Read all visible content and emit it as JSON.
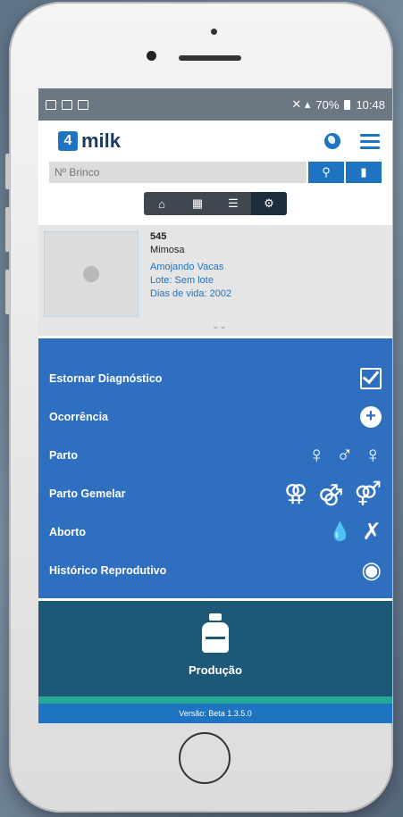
{
  "status_bar": {
    "signal": "◢",
    "battery_text": "70%",
    "time": "10:48"
  },
  "app": {
    "logo_badge": "4",
    "logo_text": "milk"
  },
  "search": {
    "placeholder": "Nº Brinco"
  },
  "animal": {
    "number": "545",
    "name": "Mimosa",
    "group": "Amojando Vacas",
    "lot": "Lote: Sem lote",
    "days": "Dias de vida: 2002"
  },
  "actions": [
    {
      "label": "Estornar Diagnóstico"
    },
    {
      "label": "Ocorrência"
    },
    {
      "label": "Parto"
    },
    {
      "label": "Parto Gemelar"
    },
    {
      "label": "Aborto"
    },
    {
      "label": "Histórico Reprodutivo"
    }
  ],
  "production": {
    "label": "Produção"
  },
  "footer": {
    "version": "Versão: Beta 1.3.5.0"
  },
  "colors": {
    "primary": "#1f74c1",
    "action_bg": "#2f6fc0",
    "production_bg": "#1d5876",
    "accent": "#23a89a"
  }
}
